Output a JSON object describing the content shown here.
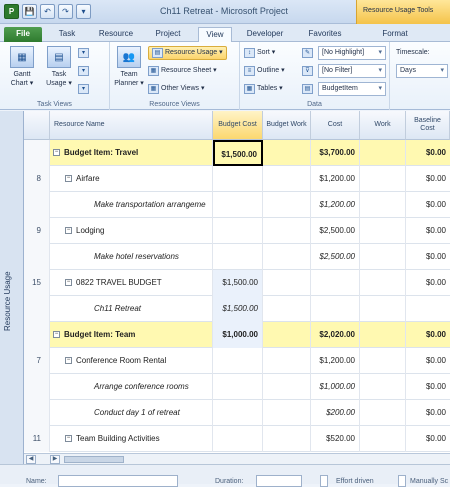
{
  "window": {
    "title": "Ch11 Retreat - Microsoft Project",
    "context_tools": "Resource Usage Tools"
  },
  "qat": {
    "app_icon": "P",
    "save": "💾",
    "undo": "↶",
    "redo": "↷",
    "customize": "▾"
  },
  "tabs": [
    "File",
    "Task",
    "Resource",
    "Project",
    "View",
    "Developer",
    "Favorites",
    "Format"
  ],
  "ribbon": {
    "task_views": {
      "gantt": "Gantt Chart ▾",
      "task_usage": "Task Usage ▾",
      "label": "Task Views"
    },
    "resource_views": {
      "team_planner": "Team Planner ▾",
      "resource_usage": "Resource Usage ▾",
      "resource_sheet": "Resource Sheet ▾",
      "other_views": "Other Views ▾",
      "label": "Resource Views"
    },
    "data": {
      "sort": "Sort ▾",
      "outline": "Outline ▾",
      "tables": "Tables ▾",
      "highlight": "[No Highlight]",
      "filter": "[No Filter]",
      "group": "BudgetItem",
      "label": "Data"
    },
    "timescale": {
      "label": "Timescale:",
      "value": "Days"
    }
  },
  "left_bar": "Resource Usage",
  "grid": {
    "headers": [
      "Resource Name",
      "Budget Cost",
      "Budget Work",
      "Cost",
      "Work",
      "Baseline Cost"
    ],
    "rows": [
      {
        "type": "group",
        "id": "",
        "name": "Budget Item: Travel",
        "budget": "$1,500.00",
        "cost": "$3,700.00",
        "base": "$0.00"
      },
      {
        "type": "res",
        "id": "8",
        "name": "Airfare",
        "budget": "",
        "cost": "$1,200.00",
        "base": "$0.00"
      },
      {
        "type": "assign",
        "id": "",
        "name": "Make transportation arrangeme",
        "budget": "",
        "cost": "$1,200.00",
        "base": "$0.00"
      },
      {
        "type": "res",
        "id": "9",
        "name": "Lodging",
        "budget": "",
        "cost": "$2,500.00",
        "base": "$0.00"
      },
      {
        "type": "assign",
        "id": "",
        "name": "Make hotel reservations",
        "budget": "",
        "cost": "$2,500.00",
        "base": "$0.00"
      },
      {
        "type": "res",
        "id": "15",
        "name": "0822 TRAVEL BUDGET",
        "budget": "$1,500.00",
        "cost": "",
        "base": "$0.00"
      },
      {
        "type": "assign",
        "id": "",
        "name": "Ch11 Retreat",
        "budget": "$1,500.00",
        "cost": "",
        "base": ""
      },
      {
        "type": "group",
        "id": "",
        "name": "Budget Item: Team",
        "budget": "$1,000.00",
        "cost": "$2,020.00",
        "base": "$0.00"
      },
      {
        "type": "res",
        "id": "7",
        "name": "Conference Room Rental",
        "budget": "",
        "cost": "$1,200.00",
        "base": "$0.00"
      },
      {
        "type": "assign",
        "id": "",
        "name": "Arrange conference rooms",
        "budget": "",
        "cost": "$1,000.00",
        "base": "$0.00"
      },
      {
        "type": "assign",
        "id": "",
        "name": "Conduct day 1 of retreat",
        "budget": "",
        "cost": "$200.00",
        "base": "$0.00"
      },
      {
        "type": "res",
        "id": "11",
        "name": "Team Building Activities",
        "budget": "",
        "cost": "$520.00",
        "base": "$0.00"
      }
    ]
  },
  "scroll": {
    "left": "◀",
    "right": "▶"
  },
  "form": {
    "name": "Name:",
    "duration": "Duration:",
    "effort": "Effort driven",
    "manual": "Manually Sc"
  }
}
